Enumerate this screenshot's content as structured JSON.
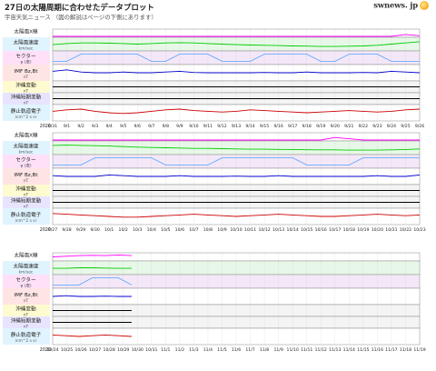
{
  "page": {
    "title": "27日の太陽周期に合わせたデータプロット",
    "subtitle": "宇宙天気ニュース （図の解説はページの下側にあります）",
    "logo": "swnews. jp"
  },
  "chart_data": [
    {
      "type": "line",
      "panel": "rotation-1",
      "start_label": "2020",
      "x_tick_labels": [
        "8/31",
        "9/1",
        "9/2",
        "9/3",
        "9/4",
        "9/5",
        "9/6",
        "9/7",
        "9/8",
        "9/9",
        "9/10",
        "9/11",
        "9/12",
        "9/13",
        "9/14",
        "9/15",
        "9/16",
        "9/17",
        "9/18",
        "9/19",
        "9/20",
        "9/21",
        "9/22",
        "9/23",
        "9/24",
        "9/25",
        "9/26"
      ],
      "data_until_fraction": 1.0,
      "rows": [
        {
          "label": "太陽風X線",
          "sublabel": "C/X比以上",
          "color": "#ff00ff",
          "series": [
            {
              "name": "X線",
              "values": [
                0,
                0,
                0,
                0,
                0,
                0,
                0,
                0,
                0,
                0,
                0,
                0,
                0,
                0,
                0,
                0,
                0,
                0,
                0,
                0,
                0,
                0,
                0,
                0,
                0,
                0.3,
                0.1
              ]
            }
          ]
        },
        {
          "label": "太陽風速度",
          "sublabel": "km/sec",
          "color": "#00cc00",
          "series": [
            {
              "name": "速度",
              "values": [
                0.45,
                0.55,
                0.6,
                0.6,
                0.58,
                0.55,
                0.5,
                0.55,
                0.6,
                0.62,
                0.6,
                0.55,
                0.5,
                0.45,
                0.42,
                0.4,
                0.38,
                0.35,
                0.33,
                0.3,
                0.3,
                0.32,
                0.35,
                0.4,
                0.5,
                0.6,
                0.7
              ]
            }
          ]
        },
        {
          "label": "セクター",
          "sublabel": "φ (度)",
          "color": "#66aaff",
          "series": [
            {
              "name": "φ",
              "values": [
                0.2,
                0.2,
                0.8,
                0.8,
                0.8,
                0.8,
                0.8,
                0.2,
                0.2,
                0.8,
                0.8,
                0.8,
                0.2,
                0.2,
                0.2,
                0.8,
                0.8,
                0.8,
                0.8,
                0.2,
                0.2,
                0.8,
                0.8,
                0.8,
                0.2,
                0.2,
                0.2
              ]
            }
          ]
        },
        {
          "label": "IMF Bz,Bt",
          "sublabel": "nT",
          "color": "#0000cc",
          "series": [
            {
              "name": "Bt",
              "values": [
                0.6,
                0.7,
                0.55,
                0.5,
                0.5,
                0.55,
                0.5,
                0.5,
                0.55,
                0.6,
                0.52,
                0.5,
                0.5,
                0.5,
                0.5,
                0.52,
                0.5,
                0.5,
                0.55,
                0.5,
                0.5,
                0.5,
                0.52,
                0.5,
                0.6,
                0.55,
                0.5
              ]
            }
          ]
        },
        {
          "label": "沖縄変動",
          "sublabel": "nT",
          "color": "#000000",
          "series": [
            {
              "name": "沖縄",
              "values": [
                0.5,
                0.5,
                0.5,
                0.5,
                0.5,
                0.5,
                0.5,
                0.5,
                0.5,
                0.5,
                0.5,
                0.5,
                0.5,
                0.5,
                0.5,
                0.5,
                0.5,
                0.5,
                0.5,
                0.5,
                0.5,
                0.5,
                0.5,
                0.5,
                0.5,
                0.5,
                0.5
              ]
            }
          ]
        },
        {
          "label": "沖縄短期変動",
          "sublabel": "nT",
          "color": "#000000",
          "series": [
            {
              "name": "短期",
              "values": [
                0.5,
                0.5,
                0.5,
                0.5,
                0.5,
                0.5,
                0.5,
                0.5,
                0.5,
                0.5,
                0.5,
                0.5,
                0.5,
                0.5,
                0.5,
                0.5,
                0.5,
                0.5,
                0.5,
                0.5,
                0.5,
                0.5,
                0.5,
                0.5,
                0.5,
                0.5,
                0.5
              ]
            }
          ]
        },
        {
          "label": "静止軌道電子",
          "sublabel": "/cm^2 s sr",
          "color": "#cc0000",
          "series": [
            {
              "name": "電子",
              "values": [
                0.6,
                0.7,
                0.75,
                0.6,
                0.5,
                0.45,
                0.5,
                0.6,
                0.7,
                0.75,
                0.65,
                0.6,
                0.55,
                0.6,
                0.7,
                0.65,
                0.6,
                0.55,
                0.5,
                0.55,
                0.6,
                0.65,
                0.6,
                0.55,
                0.6,
                0.7,
                0.75
              ]
            }
          ]
        }
      ]
    },
    {
      "type": "line",
      "panel": "rotation-2",
      "start_label": "2020",
      "x_tick_labels": [
        "9/27",
        "9/28",
        "9/29",
        "9/30",
        "10/1",
        "10/2",
        "10/3",
        "10/4",
        "10/5",
        "10/6",
        "10/7",
        "10/8",
        "10/9",
        "10/10",
        "10/11",
        "10/12",
        "10/13",
        "10/14",
        "10/15",
        "10/16",
        "10/17",
        "10/18",
        "10/19",
        "10/20",
        "10/21",
        "10/22",
        "10/23"
      ],
      "data_until_fraction": 1.0,
      "rows": [
        {
          "label": "太陽風X線",
          "sublabel": "C/X比以上",
          "color": "#ff00ff",
          "series": [
            {
              "name": "X線",
              "values": [
                0,
                0,
                0,
                0,
                0,
                0,
                0,
                0,
                0,
                0,
                0,
                0,
                0,
                0,
                0,
                0,
                0,
                0,
                0,
                0,
                0.4,
                0.2,
                0,
                0,
                0,
                0,
                0
              ]
            }
          ]
        },
        {
          "label": "太陽風速度",
          "sublabel": "km/sec",
          "color": "#00cc00",
          "series": [
            {
              "name": "速度",
              "values": [
                0.7,
                0.72,
                0.7,
                0.68,
                0.65,
                0.6,
                0.55,
                0.52,
                0.5,
                0.48,
                0.45,
                0.45,
                0.42,
                0.4,
                0.38,
                0.38,
                0.36,
                0.35,
                0.33,
                0.32,
                0.32,
                0.3,
                0.3,
                0.3,
                0.32,
                0.35,
                0.4
              ]
            }
          ]
        },
        {
          "label": "セクター",
          "sublabel": "φ (度)",
          "color": "#66aaff",
          "series": [
            {
              "name": "φ",
              "values": [
                0.2,
                0.2,
                0.2,
                0.8,
                0.8,
                0.8,
                0.8,
                0.8,
                0.2,
                0.2,
                0.2,
                0.2,
                0.8,
                0.8,
                0.8,
                0.8,
                0.8,
                0.8,
                0.2,
                0.2,
                0.2,
                0.2,
                0.8,
                0.8,
                0.8,
                0.8,
                0.8
              ]
            }
          ]
        },
        {
          "label": "IMF Bz,Bt",
          "sublabel": "nT",
          "color": "#0000cc",
          "series": [
            {
              "name": "Bt",
              "values": [
                0.55,
                0.5,
                0.5,
                0.5,
                0.6,
                0.55,
                0.5,
                0.5,
                0.5,
                0.55,
                0.5,
                0.5,
                0.5,
                0.52,
                0.5,
                0.5,
                0.55,
                0.5,
                0.5,
                0.5,
                0.5,
                0.5,
                0.5,
                0.55,
                0.5,
                0.5,
                0.6
              ]
            }
          ]
        },
        {
          "label": "沖縄変動",
          "sublabel": "nT",
          "color": "#000000",
          "series": [
            {
              "name": "沖縄",
              "values": [
                0.5,
                0.5,
                0.5,
                0.5,
                0.5,
                0.5,
                0.5,
                0.5,
                0.5,
                0.5,
                0.5,
                0.5,
                0.5,
                0.5,
                0.5,
                0.5,
                0.5,
                0.5,
                0.5,
                0.5,
                0.5,
                0.5,
                0.5,
                0.5,
                0.5,
                0.5,
                0.5
              ]
            }
          ]
        },
        {
          "label": "沖縄短期変動",
          "sublabel": "nT",
          "color": "#000000",
          "series": [
            {
              "name": "短期",
              "values": [
                0.5,
                0.5,
                0.5,
                0.5,
                0.5,
                0.5,
                0.5,
                0.5,
                0.5,
                0.5,
                0.5,
                0.5,
                0.5,
                0.5,
                0.5,
                0.5,
                0.5,
                0.5,
                0.5,
                0.5,
                0.5,
                0.5,
                0.5,
                0.5,
                0.5,
                0.5,
                0.5
              ]
            }
          ]
        },
        {
          "label": "静止軌道電子",
          "sublabel": "/cm^2 s sr",
          "color": "#cc0000",
          "series": [
            {
              "name": "電子",
              "values": [
                0.7,
                0.65,
                0.6,
                0.55,
                0.5,
                0.45,
                0.45,
                0.5,
                0.55,
                0.6,
                0.65,
                0.6,
                0.55,
                0.5,
                0.55,
                0.6,
                0.65,
                0.6,
                0.55,
                0.5,
                0.5,
                0.55,
                0.6,
                0.65,
                0.6,
                0.55,
                0.6
              ]
            }
          ]
        }
      ]
    },
    {
      "type": "line",
      "panel": "rotation-3",
      "start_label": "2020",
      "x_tick_labels": [
        "10/24",
        "10/25",
        "10/26",
        "10/27",
        "10/28",
        "10/29",
        "10/30",
        "10/31",
        "11/1",
        "11/2",
        "11/3",
        "11/4",
        "11/5",
        "11/6",
        "11/7",
        "11/8",
        "11/9",
        "11/10",
        "11/11",
        "11/12",
        "11/13",
        "11/14",
        "11/15",
        "11/16",
        "11/17",
        "11/18",
        "11/19"
      ],
      "data_until_fraction": 0.215,
      "rows": [
        {
          "label": "太陽風X線",
          "sublabel": "C/X比以上",
          "color": "#ff00ff",
          "series": [
            {
              "name": "X線",
              "values": [
                0.5,
                0.6,
                0.7,
                0.75,
                0.7,
                0.8,
                0.7
              ]
            }
          ]
        },
        {
          "label": "太陽風速度",
          "sublabel": "km/sec",
          "color": "#00cc00",
          "series": [
            {
              "name": "速度",
              "values": [
                0.45,
                0.45,
                0.5,
                0.5,
                0.48,
                0.45,
                0.45
              ]
            }
          ]
        },
        {
          "label": "セクター",
          "sublabel": "φ (度)",
          "color": "#66aaff",
          "series": [
            {
              "name": "φ",
              "values": [
                0.2,
                0.2,
                0.2,
                0.8,
                0.8,
                0.8,
                0.2
              ]
            }
          ]
        },
        {
          "label": "IMF Bz,Bt",
          "sublabel": "nT",
          "color": "#0000cc",
          "series": [
            {
              "name": "Bt",
              "values": [
                0.5,
                0.55,
                0.5,
                0.5,
                0.52,
                0.5,
                0.5
              ]
            }
          ]
        },
        {
          "label": "沖縄変動",
          "sublabel": "nT",
          "color": "#000000",
          "series": [
            {
              "name": "沖縄",
              "values": [
                0.5,
                0.5,
                0.5,
                0.5,
                0.5,
                0.5,
                0.5
              ]
            }
          ]
        },
        {
          "label": "沖縄短期変動",
          "sublabel": "nT",
          "color": "#000000",
          "series": [
            {
              "name": "短期",
              "values": [
                0.5,
                0.5,
                0.5,
                0.5,
                0.5,
                0.5,
                0.5
              ]
            }
          ]
        },
        {
          "label": "静止軌道電子",
          "sublabel": "/cm^2 s sr",
          "color": "#cc0000",
          "series": [
            {
              "name": "電子",
              "values": [
                0.6,
                0.55,
                0.5,
                0.55,
                0.6,
                0.55,
                0.5
              ]
            }
          ]
        }
      ]
    }
  ]
}
